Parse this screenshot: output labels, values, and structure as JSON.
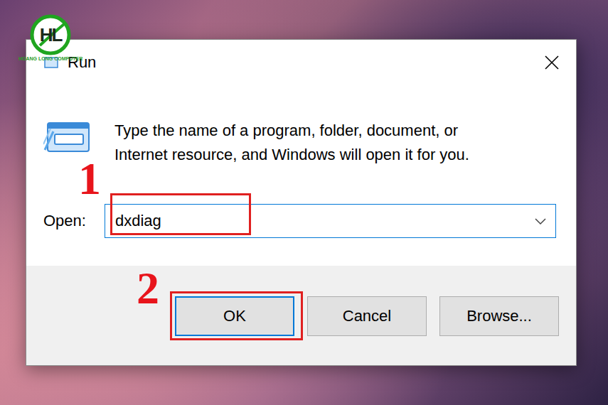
{
  "logo": {
    "mark": "HL",
    "caption": "HOANG LONG COMPUTER"
  },
  "window": {
    "title": "Run"
  },
  "description": {
    "lines": [
      "Type the name of a program, folder, document, or",
      "Internet resource, and Windows will open it for you."
    ]
  },
  "field": {
    "label": "Open:",
    "value": "dxdiag"
  },
  "buttons": [
    {
      "label": "OK",
      "selected": true
    },
    {
      "label": "Cancel",
      "selected": false
    },
    {
      "label": "Browse...",
      "selected": false
    }
  ],
  "annotations": [
    {
      "number": "1"
    },
    {
      "number": "2"
    }
  ]
}
